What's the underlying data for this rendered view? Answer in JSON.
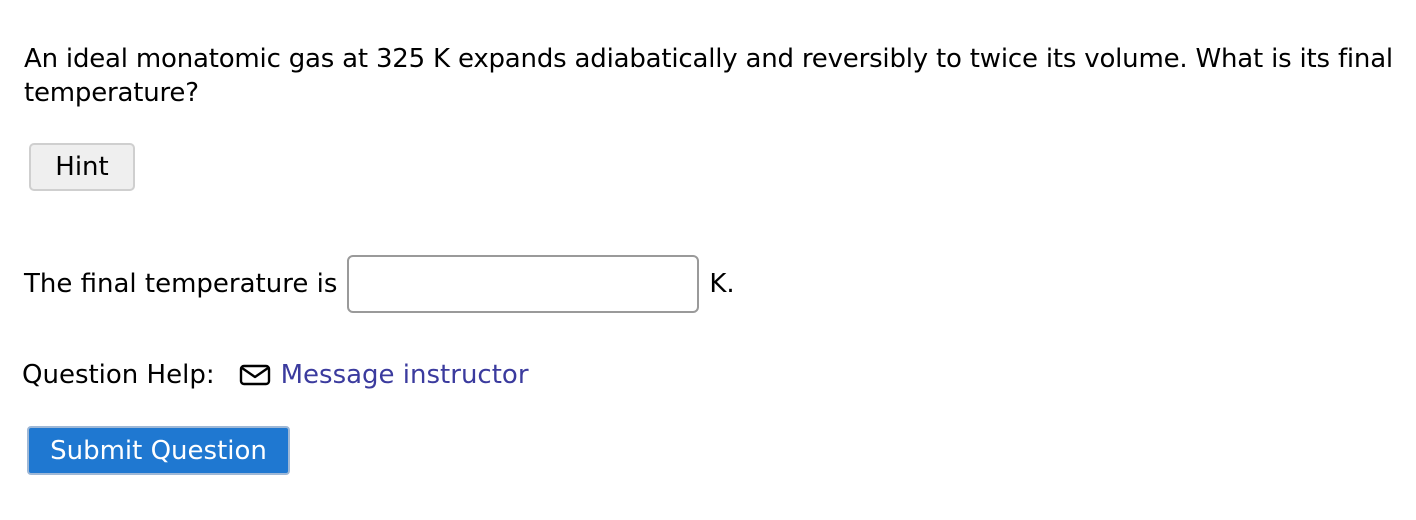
{
  "question": {
    "text": "An ideal monatomic gas at 325 K expands adiabatically and reversibly to twice its volume. What is its final temperature?"
  },
  "hint": {
    "label": "Hint"
  },
  "answer": {
    "prefix": "The final temperature is",
    "value": "",
    "placeholder": "",
    "unit": "K."
  },
  "help": {
    "label": "Question Help:",
    "link_label": "Message instructor",
    "link_icon": "mail-icon"
  },
  "submit": {
    "label": "Submit Question"
  },
  "colors": {
    "link": "#3b3b9e",
    "submit_bg": "#1f78d1",
    "hint_bg": "#efefef"
  }
}
